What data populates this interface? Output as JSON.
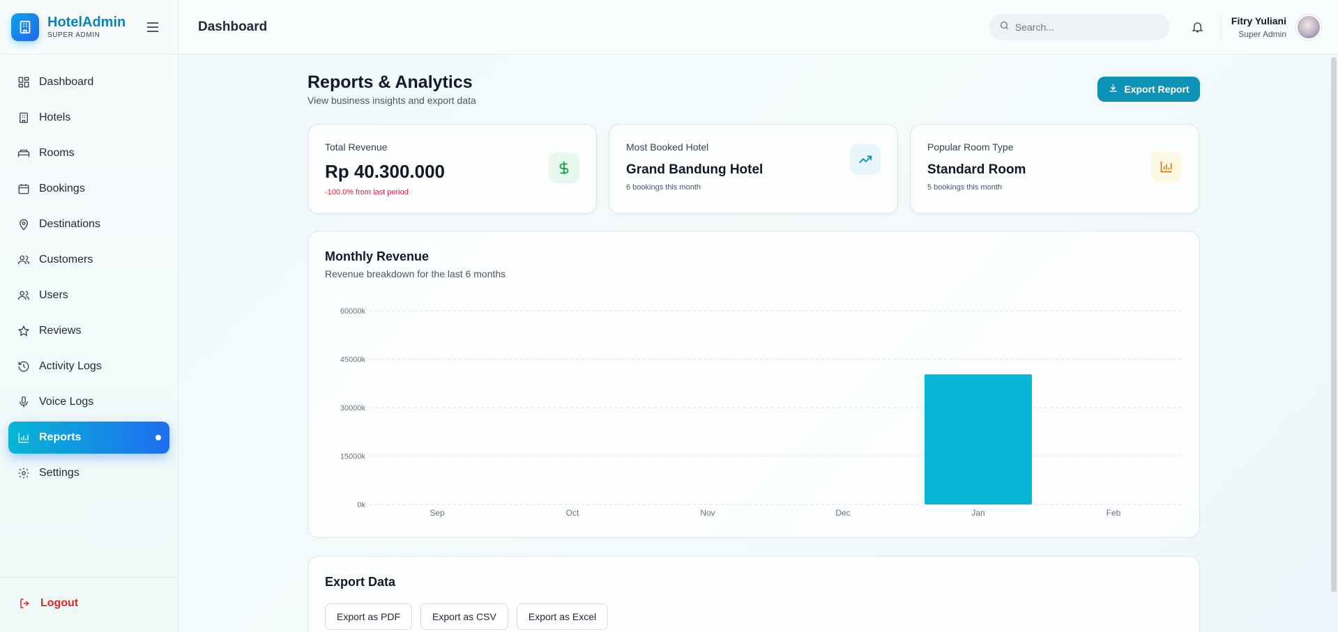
{
  "brand": {
    "name": "HotelAdmin",
    "role": "SUPER ADMIN"
  },
  "sidebar": {
    "items": [
      {
        "label": "Dashboard",
        "icon": "dashboard-icon"
      },
      {
        "label": "Hotels",
        "icon": "building-icon"
      },
      {
        "label": "Rooms",
        "icon": "bed-icon"
      },
      {
        "label": "Bookings",
        "icon": "calendar-icon"
      },
      {
        "label": "Destinations",
        "icon": "map-pin-icon"
      },
      {
        "label": "Customers",
        "icon": "users-icon"
      },
      {
        "label": "Users",
        "icon": "users-icon"
      },
      {
        "label": "Reviews",
        "icon": "star-icon"
      },
      {
        "label": "Activity Logs",
        "icon": "history-icon"
      },
      {
        "label": "Voice Logs",
        "icon": "mic-icon"
      },
      {
        "label": "Reports",
        "icon": "bar-chart-icon",
        "active": true
      },
      {
        "label": "Settings",
        "icon": "gear-icon"
      }
    ],
    "logout_label": "Logout"
  },
  "header": {
    "title": "Dashboard",
    "search_placeholder": "Search...",
    "user_name": "Fitry Yuliani",
    "user_role": "Super Admin"
  },
  "page": {
    "title": "Reports & Analytics",
    "subtitle": "View business insights and export data",
    "export_label": "Export Report"
  },
  "cards": [
    {
      "label": "Total Revenue",
      "value": "Rp 40.300.000",
      "note": "-100.0% from last period"
    },
    {
      "label": "Most Booked Hotel",
      "value": "Grand Bandung Hotel",
      "note": "6 bookings this month"
    },
    {
      "label": "Popular Room Type",
      "value": "Standard Room",
      "note": "5 bookings this month"
    }
  ],
  "chart": {
    "title": "Monthly Revenue",
    "subtitle": "Revenue breakdown for the last 6 months"
  },
  "chart_data": {
    "type": "bar",
    "categories": [
      "Sep",
      "Oct",
      "Nov",
      "Dec",
      "Jan",
      "Feb"
    ],
    "values": [
      0,
      0,
      0,
      0,
      40300,
      0
    ],
    "yticks": [
      "0k",
      "15000k",
      "30000k",
      "45000k",
      "60000k"
    ],
    "ylim": [
      0,
      60000
    ],
    "grid": true,
    "bar_color": "#06b6d4"
  },
  "export": {
    "title": "Export Data",
    "buttons": [
      "Export as PDF",
      "Export as CSV",
      "Export as Excel"
    ]
  },
  "colors": {
    "accent": "#0e93b8",
    "active_nav_start": "#06b6d4",
    "active_nav_end": "#1d6ef0",
    "danger": "#dc2626"
  }
}
